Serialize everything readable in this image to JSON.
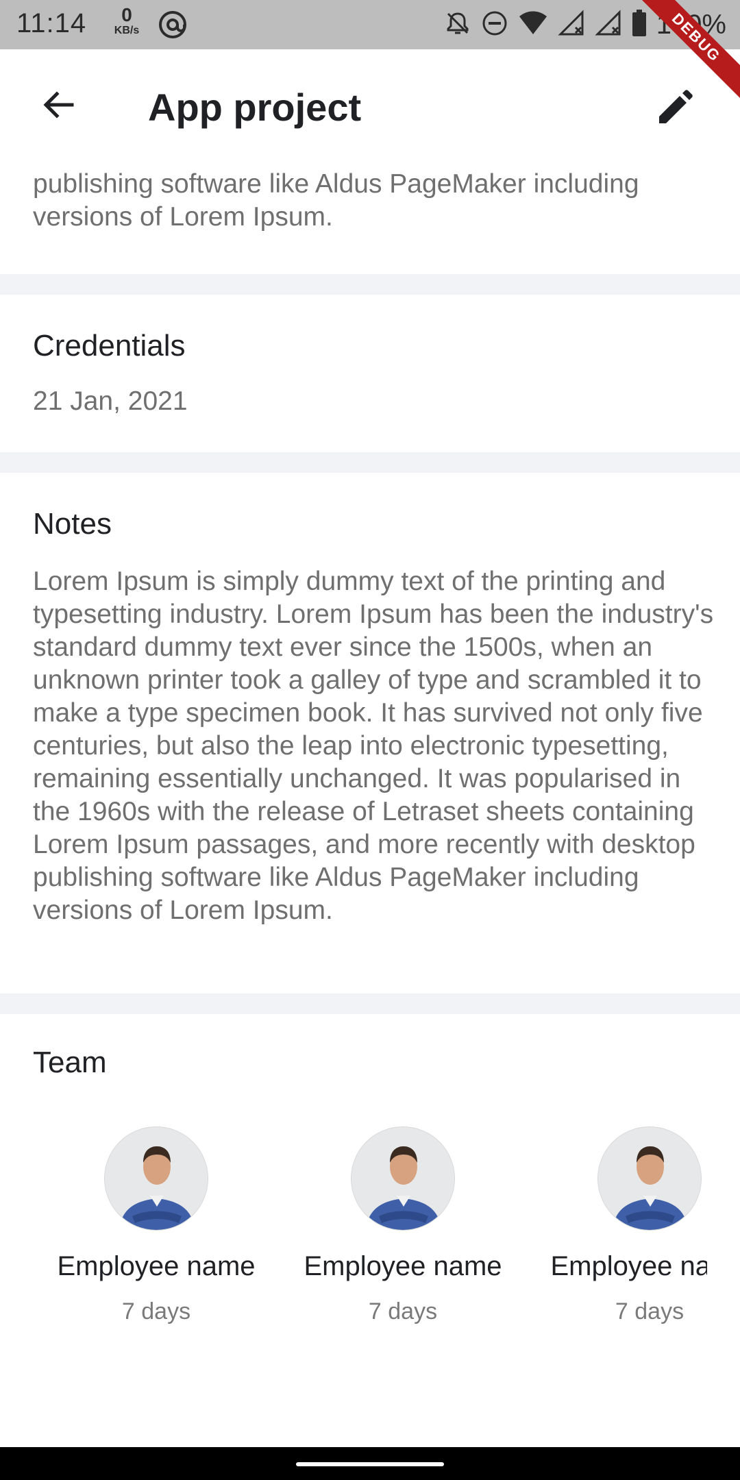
{
  "status_bar": {
    "time": "11:14",
    "net_speed_value": "0",
    "net_speed_unit": "KB/s",
    "battery": "100%"
  },
  "debug_banner": "DEBUG",
  "app_bar": {
    "title": "App project"
  },
  "description_tail": "Lorem Ipsum passages, and more recently with desktop publishing software like Aldus PageMaker including versions of Lorem Ipsum.",
  "credentials": {
    "title": "Credentials",
    "date": "21 Jan, 2021"
  },
  "notes": {
    "title": "Notes",
    "body": "Lorem Ipsum is simply dummy text of the printing and typesetting industry. Lorem Ipsum has been the industry's standard dummy text ever since the 1500s, when an unknown printer took a galley of type and scrambled it to make a type specimen book. It has survived not only five centuries, but also the leap into electronic typesetting, remaining essentially unchanged. It was popularised in the 1960s with the release of Letraset sheets containing Lorem Ipsum passages, and more recently with desktop publishing software like Aldus PageMaker including versions of Lorem Ipsum."
  },
  "team": {
    "title": "Team",
    "members": [
      {
        "name": "Employee name",
        "days": "7 days"
      },
      {
        "name": "Employee name",
        "days": "7 days"
      },
      {
        "name": "Employee name",
        "days": "7 days"
      }
    ]
  },
  "colors": {
    "divider": "#f1f3f7",
    "secondary_text": "#6f6f6f",
    "debug_ribbon": "#b71c1c",
    "avatar_shirt": "#3f5fa8"
  }
}
